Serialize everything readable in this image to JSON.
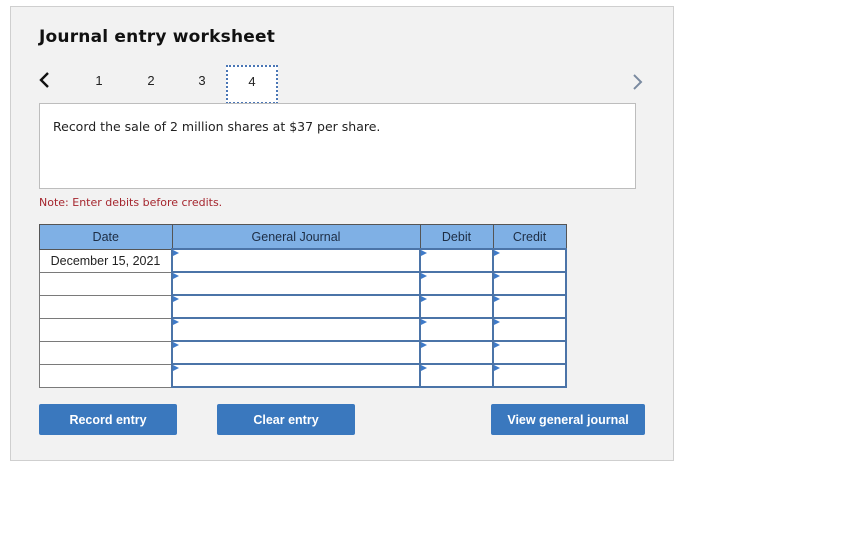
{
  "worksheet": {
    "title": "Journal entry worksheet",
    "nav": {
      "prev_icon": "chevron-left-icon",
      "next_icon": "chevron-right-icon",
      "steps": [
        "1",
        "2",
        "3",
        "4"
      ],
      "active_step": "4"
    },
    "question": "Record the sale of 2 million shares at $37 per share.",
    "note": "Note: Enter debits before credits."
  },
  "table": {
    "headers": [
      "Date",
      "General Journal",
      "Debit",
      "Credit"
    ],
    "rows": [
      {
        "date": "December 15, 2021",
        "account": "",
        "debit": "",
        "credit": ""
      },
      {
        "date": "",
        "account": "",
        "debit": "",
        "credit": ""
      },
      {
        "date": "",
        "account": "",
        "debit": "",
        "credit": ""
      },
      {
        "date": "",
        "account": "",
        "debit": "",
        "credit": ""
      },
      {
        "date": "",
        "account": "",
        "debit": "",
        "credit": ""
      },
      {
        "date": "",
        "account": "",
        "debit": "",
        "credit": ""
      }
    ]
  },
  "buttons": {
    "record": "Record entry",
    "clear": "Clear entry",
    "view": "View general journal"
  },
  "colors": {
    "accent": "#3a78be",
    "header_bg": "#7fb0e5",
    "note": "#a5262e"
  }
}
